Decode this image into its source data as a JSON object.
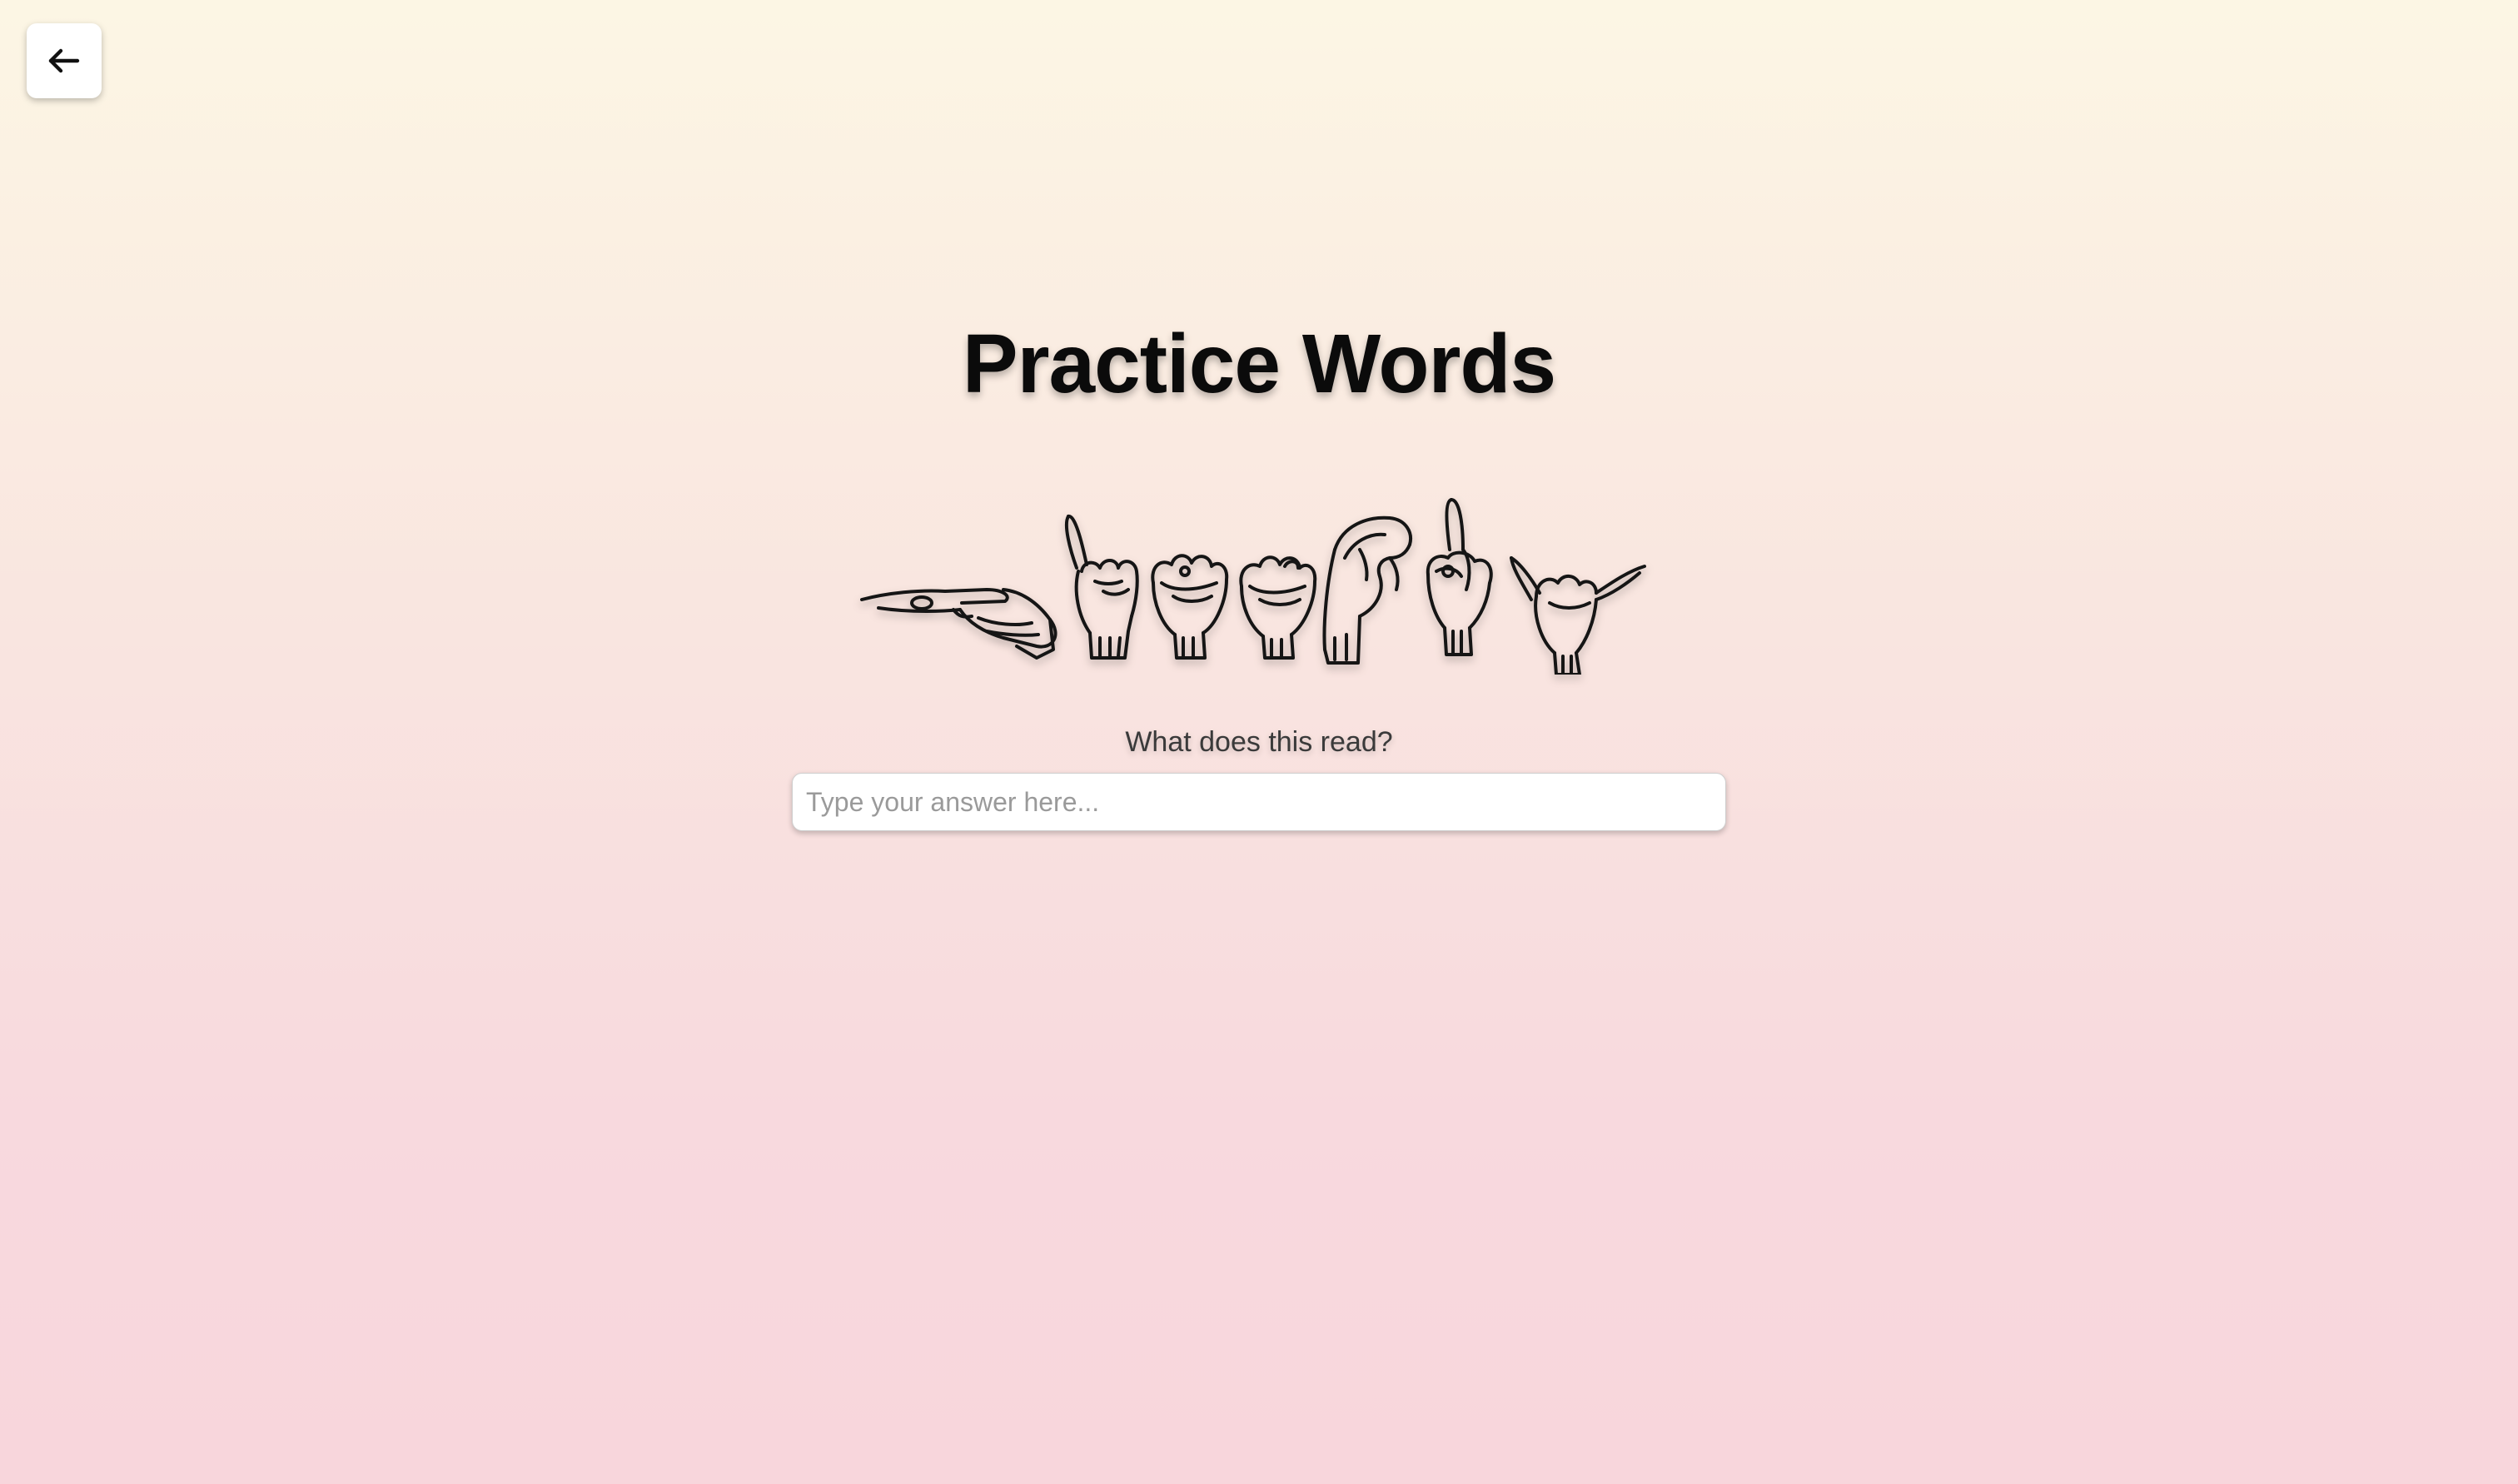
{
  "header": {
    "back_button_icon": "arrow-left-icon"
  },
  "main": {
    "title": "Practice Words",
    "sign_images": [
      "hand-sign-1-icon",
      "hand-sign-2-icon",
      "hand-sign-3-icon",
      "hand-sign-4-icon",
      "hand-sign-5-icon",
      "hand-sign-6-icon",
      "hand-sign-7-icon"
    ],
    "prompt": "What does this read?",
    "answer_input": {
      "value": "",
      "placeholder": "Type your answer here..."
    }
  },
  "colors": {
    "background_top": "#fcf6e4",
    "background_bottom": "#f8d6dc",
    "title_text": "#0b0b0b"
  }
}
